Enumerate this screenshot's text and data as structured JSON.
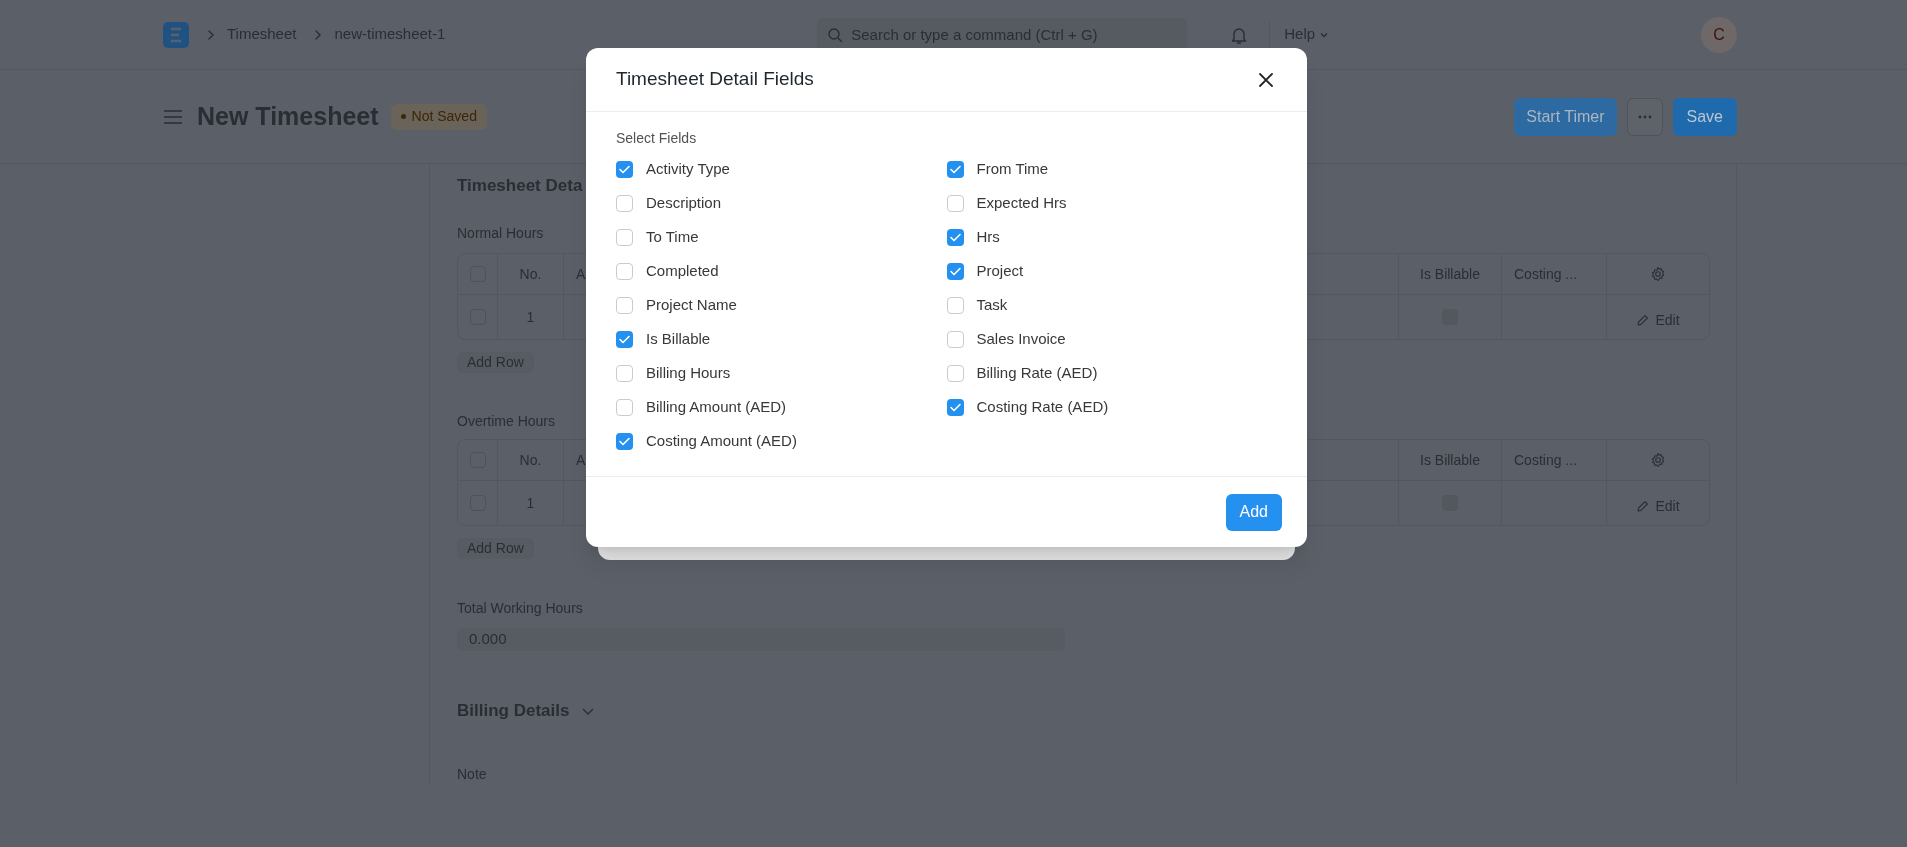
{
  "navbar": {
    "breadcrumbs": [
      "Timesheet",
      "new-timesheet-1"
    ],
    "search": {
      "placeholder": "Search or type a command (Ctrl + G)"
    },
    "help": "Help",
    "avatar": "C"
  },
  "page_header": {
    "title": "New Timesheet",
    "status": "Not Saved",
    "buttons": [
      {
        "label": "Start Timer",
        "kind": "secondary"
      },
      {
        "label": "Save",
        "kind": "primary"
      }
    ]
  },
  "form": {
    "section_title": "Timesheet Deta",
    "tables": [
      {
        "label": "Normal Hours",
        "all_selected": false,
        "columns": [
          "No.",
          "A",
          "Is Billable",
          "Costing ..."
        ],
        "rows": [
          {
            "no": "1",
            "selected": false,
            "is_billable": false,
            "action": "Edit"
          }
        ],
        "add_row": "Add Row"
      },
      {
        "label": "Overtime Hours",
        "all_selected": false,
        "columns": [
          "No.",
          "A",
          "Is Billable",
          "Costing ..."
        ],
        "rows": [
          {
            "no": "1",
            "selected": false,
            "is_billable": false,
            "action": "Edit"
          }
        ],
        "add_row": "Add Row"
      }
    ],
    "total": {
      "label": "Total Working Hours",
      "value": "0.000"
    },
    "billing_section": "Billing Details",
    "note_label": "Note"
  },
  "modal": {
    "title": "Timesheet Detail Fields",
    "group_label": "Select Fields",
    "button": "Add",
    "fields": [
      {
        "label": "Activity Type",
        "checked": true
      },
      {
        "label": "From Time",
        "checked": true
      },
      {
        "label": "Description",
        "checked": false
      },
      {
        "label": "Expected Hrs",
        "checked": false
      },
      {
        "label": "To Time",
        "checked": false
      },
      {
        "label": "Hrs",
        "checked": true
      },
      {
        "label": "Completed",
        "checked": false
      },
      {
        "label": "Project",
        "checked": true
      },
      {
        "label": "Project Name",
        "checked": false
      },
      {
        "label": "Task",
        "checked": false
      },
      {
        "label": "Is Billable",
        "checked": true
      },
      {
        "label": "Sales Invoice",
        "checked": false
      },
      {
        "label": "Billing Hours",
        "checked": false
      },
      {
        "label": "Billing Rate (AED)",
        "checked": false
      },
      {
        "label": "Billing Amount (AED)",
        "checked": false
      },
      {
        "label": "Costing Rate (AED)",
        "checked": true
      },
      {
        "label": "Costing Amount (AED)",
        "checked": true
      }
    ]
  }
}
